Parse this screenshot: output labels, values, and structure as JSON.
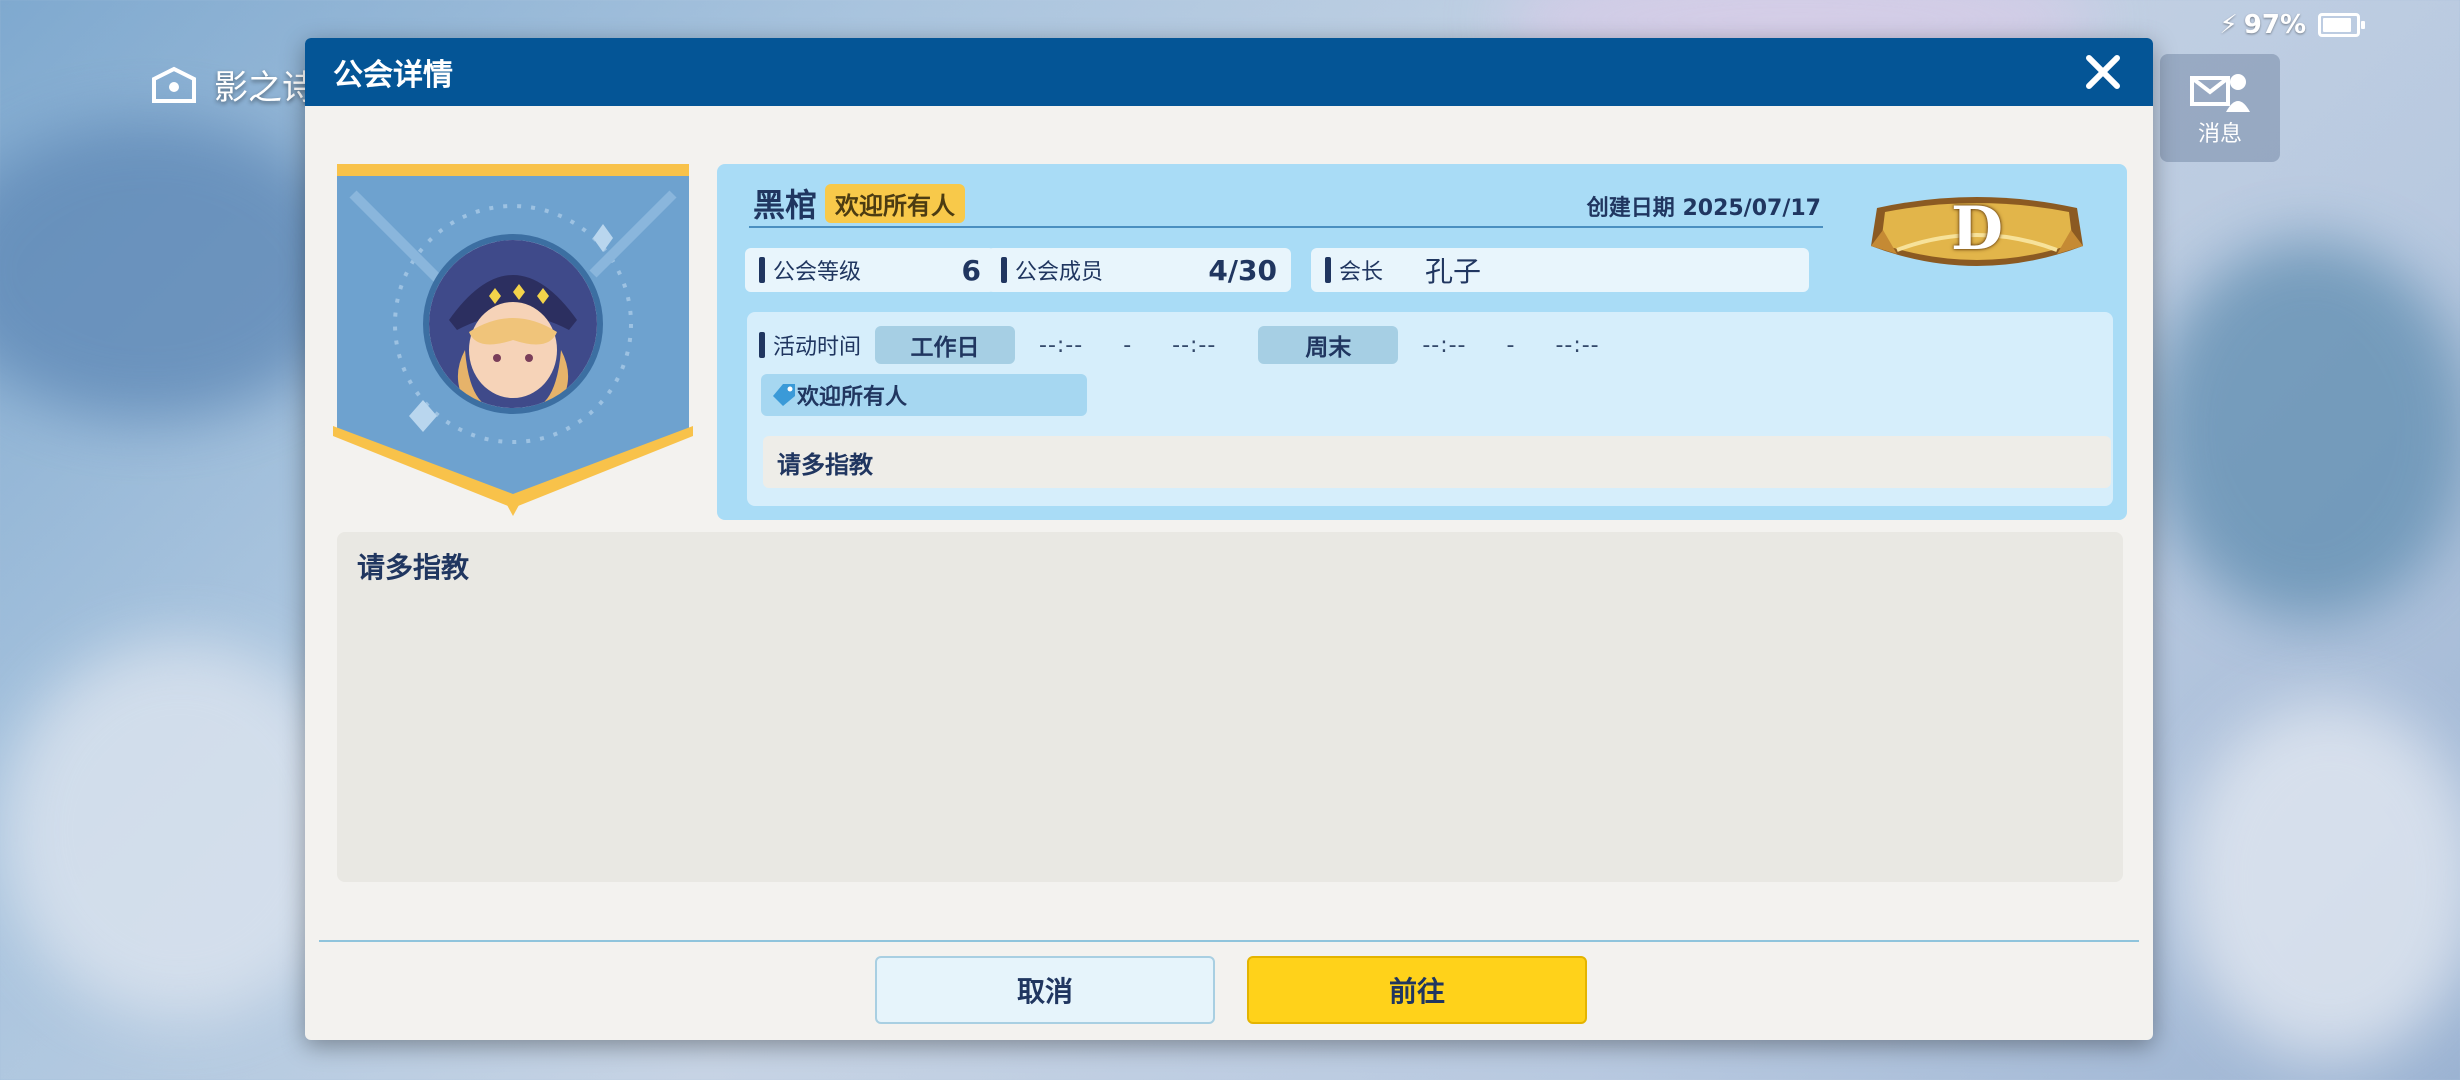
{
  "status_bar": {
    "battery_text": "97%"
  },
  "top_bar": {
    "title": "影之诗"
  },
  "message_button": {
    "label": "消息"
  },
  "dialog": {
    "title": "公会详情",
    "guild": {
      "name": "黑棺",
      "tag": "欢迎所有人",
      "created": "创建日期 2025/07/17",
      "rank": "D",
      "level_label": "公会等级",
      "level_value": "6",
      "members_label": "公会成员",
      "members_value": "4/30",
      "leader_label": "会长",
      "leader_value": "孔子"
    },
    "activity": {
      "label": "活动时间",
      "weekday_label": "工作日",
      "weekday_start": "--:--",
      "weekday_sep": "-",
      "weekday_end": "--:--",
      "weekend_label": "周末",
      "weekend_start": "--:--",
      "weekend_sep": "-",
      "weekend_end": "--:--"
    },
    "welcome_tag": "欢迎所有人",
    "slogan": "请多指教",
    "notice": "请多指教",
    "buttons": {
      "cancel": "取消",
      "go": "前往"
    }
  }
}
